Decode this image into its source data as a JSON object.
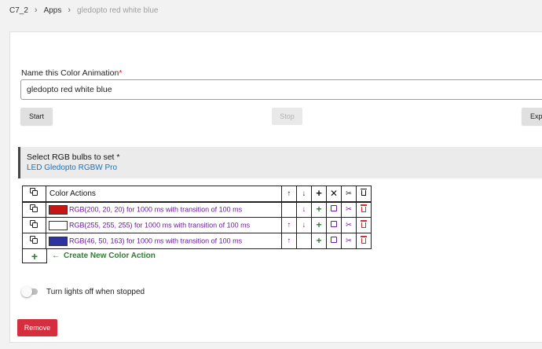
{
  "breadcrumb": {
    "items": [
      "C7_2",
      "Apps"
    ],
    "current": "gledopto red white blue"
  },
  "name_field": {
    "label": "Name this Color Animation",
    "required_mark": "*",
    "value": "gledopto red white blue"
  },
  "buttons": {
    "start": "Start",
    "stop": "Stop",
    "export": "Expo"
  },
  "bulbs": {
    "title": "Select RGB bulbs to set *",
    "selected": "LED Gledopto RGBW Pro"
  },
  "actions_table": {
    "header_label": "Color Actions",
    "header_icons": [
      "copy-icon",
      "arrow-up-icon",
      "arrow-down-icon",
      "plus-icon",
      "x-icon",
      "scissors-icon",
      "trash-icon"
    ],
    "rows": [
      {
        "description": "RGB(200, 20, 20) for 1000 ms with transition of 100 ms",
        "swatch_color": "#c81414",
        "can_move_up": false,
        "can_move_down": true
      },
      {
        "description": "RGB(255, 255, 255) for 1000 ms with transition of 100 ms",
        "swatch_color": "#ffffff",
        "can_move_up": true,
        "can_move_down": true
      },
      {
        "description": "RGB(46, 50, 163) for 1000 ms with transition of 100 ms",
        "swatch_color": "#2e32a3",
        "can_move_up": true,
        "can_move_down": false
      }
    ]
  },
  "create_action": {
    "label": "Create New Color Action"
  },
  "toggle": {
    "label": "Turn lights off when stopped",
    "checked": false
  },
  "remove_button": {
    "label": "Remove"
  },
  "colors": {
    "accent_link": "#1a73b8",
    "green": "#2e7d32",
    "purple": "#6a1b9a",
    "danger": "#d32f3f"
  }
}
